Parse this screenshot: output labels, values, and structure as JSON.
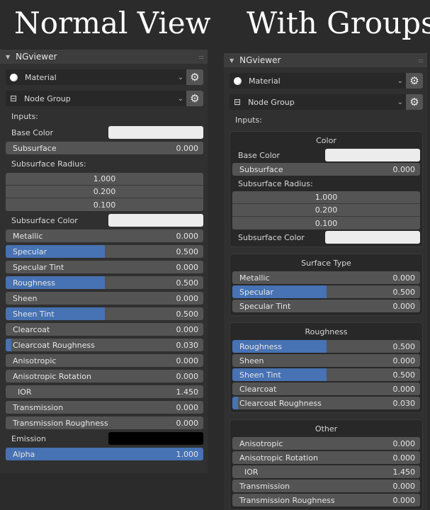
{
  "titles": {
    "left": "Normal View",
    "right": "With Groups"
  },
  "panel": {
    "name": "NGviewer",
    "material": "Material",
    "node_group": "Node Group",
    "inputs": "Inputs:"
  },
  "colors": {
    "accent": "#4772b3",
    "white": "#ececec",
    "black": "#000000"
  },
  "left_rows": [
    {
      "t": "color",
      "label": "Base Color",
      "color": "#ececec"
    },
    {
      "t": "slider",
      "label": "Subsurface",
      "value": "0.000",
      "fill": 0
    },
    {
      "t": "label",
      "label": "Subsurface Radius:"
    },
    {
      "t": "vector",
      "values": [
        "1.000",
        "0.200",
        "0.100"
      ]
    },
    {
      "t": "color",
      "label": "Subsurface Color",
      "color": "#ececec"
    },
    {
      "t": "slider",
      "label": "Metallic",
      "value": "0.000",
      "fill": 0
    },
    {
      "t": "slider",
      "label": "Specular",
      "value": "0.500",
      "fill": 0.5
    },
    {
      "t": "slider",
      "label": "Specular Tint",
      "value": "0.000",
      "fill": 0
    },
    {
      "t": "slider",
      "label": "Roughness",
      "value": "0.500",
      "fill": 0.5
    },
    {
      "t": "slider",
      "label": "Sheen",
      "value": "0.000",
      "fill": 0
    },
    {
      "t": "slider",
      "label": "Sheen Tint",
      "value": "0.500",
      "fill": 0.5
    },
    {
      "t": "slider",
      "label": "Clearcoat",
      "value": "0.000",
      "fill": 0
    },
    {
      "t": "slider",
      "label": "Clearcoat Roughness",
      "value": "0.030",
      "fill": 0.03
    },
    {
      "t": "slider",
      "label": "Anisotropic",
      "value": "0.000",
      "fill": 0
    },
    {
      "t": "slider",
      "label": "Anisotropic Rotation",
      "value": "0.000",
      "fill": 0
    },
    {
      "t": "slider",
      "label": "  IOR",
      "value": "1.450",
      "fill": 0
    },
    {
      "t": "slider",
      "label": "Transmission",
      "value": "0.000",
      "fill": 0
    },
    {
      "t": "slider",
      "label": "Transmission Roughness",
      "value": "0.000",
      "fill": 0
    },
    {
      "t": "color",
      "label": "Emission",
      "color": "#000000"
    },
    {
      "t": "slider",
      "label": "Alpha",
      "value": "1.000",
      "fill": 1
    }
  ],
  "groups": [
    {
      "title": "Color",
      "rows": [
        {
          "t": "color",
          "label": "Base Color",
          "color": "#ececec"
        },
        {
          "t": "slider",
          "label": "Subsurface",
          "value": "0.000",
          "fill": 0
        },
        {
          "t": "label",
          "label": "Subsurface Radius:"
        },
        {
          "t": "vector",
          "values": [
            "1.000",
            "0.200",
            "0.100"
          ]
        },
        {
          "t": "color",
          "label": "Subsurface Color",
          "color": "#ececec"
        }
      ]
    },
    {
      "title": "Surface Type",
      "rows": [
        {
          "t": "slider",
          "label": "Metallic",
          "value": "0.000",
          "fill": 0
        },
        {
          "t": "slider",
          "label": "Specular",
          "value": "0.500",
          "fill": 0.5
        },
        {
          "t": "slider",
          "label": "Specular Tint",
          "value": "0.000",
          "fill": 0
        }
      ]
    },
    {
      "title": "Roughness",
      "rows": [
        {
          "t": "slider",
          "label": "Roughness",
          "value": "0.500",
          "fill": 0.5
        },
        {
          "t": "slider",
          "label": "Sheen",
          "value": "0.000",
          "fill": 0
        },
        {
          "t": "slider",
          "label": "Sheen Tint",
          "value": "0.500",
          "fill": 0.5
        },
        {
          "t": "slider",
          "label": "Clearcoat",
          "value": "0.000",
          "fill": 0
        },
        {
          "t": "slider",
          "label": "Clearcoat Roughness",
          "value": "0.030",
          "fill": 0.03
        }
      ]
    },
    {
      "title": "Other",
      "rows": [
        {
          "t": "slider",
          "label": "Anisotropic",
          "value": "0.000",
          "fill": 0
        },
        {
          "t": "slider",
          "label": "Anisotropic Rotation",
          "value": "0.000",
          "fill": 0
        },
        {
          "t": "slider",
          "label": "  IOR",
          "value": "1.450",
          "fill": 0
        },
        {
          "t": "slider",
          "label": "Transmission",
          "value": "0.000",
          "fill": 0
        },
        {
          "t": "slider",
          "label": "Transmission Roughness",
          "value": "0.000",
          "fill": 0
        }
      ]
    }
  ]
}
